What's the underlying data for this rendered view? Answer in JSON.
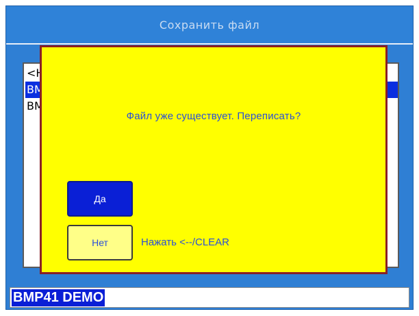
{
  "window": {
    "title": "Сохранить файл"
  },
  "file_list": {
    "items": [
      {
        "label": "<Н",
        "selected": false
      },
      {
        "label": "BM",
        "selected": true
      },
      {
        "label": "BM",
        "selected": false
      }
    ]
  },
  "dialog": {
    "message": "Файл уже существует. Переписать?",
    "yes_label": "Да",
    "no_label": "Нет",
    "hint": "Нажать <--/CLEAR"
  },
  "filename": {
    "value": "BMP41 DEMO"
  },
  "colors": {
    "background": "#2f7fd4",
    "dialog_bg": "#ffff00",
    "dialog_border": "#8a1f25",
    "selection": "#0a2ee0",
    "dialog_text": "#2a50d8"
  }
}
